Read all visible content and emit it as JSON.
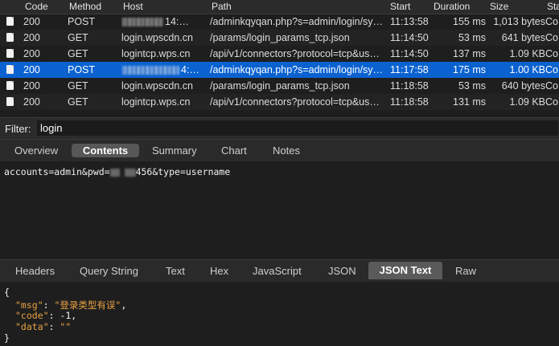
{
  "table": {
    "columns": [
      "Code",
      "Method",
      "Host",
      "Path",
      "Start",
      "Duration",
      "Size",
      "Sta"
    ],
    "rows": [
      {
        "code": "200",
        "method": "POST",
        "host": "14:…",
        "path": "/adminkqyqan.php?s=admin/login/sy…",
        "start": "11:13:58",
        "duration": "155 ms",
        "size": "1,013 bytes",
        "status": "Co",
        "masked": true,
        "selected": false
      },
      {
        "code": "200",
        "method": "GET",
        "host": "login.wpscdn.cn",
        "path": "/params/login_params_tcp.json",
        "start": "11:14:50",
        "duration": "53 ms",
        "size": "641 bytes",
        "status": "Co",
        "masked": false,
        "selected": false
      },
      {
        "code": "200",
        "method": "GET",
        "host": "logintcp.wps.cn",
        "path": "/api/v1/connectors?protocol=tcp&us…",
        "start": "11:14:50",
        "duration": "137 ms",
        "size": "1.09 KB",
        "status": "Co",
        "masked": false,
        "selected": false
      },
      {
        "code": "200",
        "method": "POST",
        "host": "4:…",
        "path": "/adminkqyqan.php?s=admin/login/sy…",
        "start": "11:17:58",
        "duration": "175 ms",
        "size": "1.00 KB",
        "status": "Co",
        "masked": true,
        "selected": true
      },
      {
        "code": "200",
        "method": "GET",
        "host": "login.wpscdn.cn",
        "path": "/params/login_params_tcp.json",
        "start": "11:18:58",
        "duration": "53 ms",
        "size": "640 bytes",
        "status": "Co",
        "masked": false,
        "selected": false
      },
      {
        "code": "200",
        "method": "GET",
        "host": "logintcp.wps.cn",
        "path": "/api/v1/connectors?protocol=tcp&us…",
        "start": "11:18:58",
        "duration": "131 ms",
        "size": "1.09 KB",
        "status": "Co",
        "masked": false,
        "selected": false
      }
    ]
  },
  "filter": {
    "label": "Filter:",
    "value": "login"
  },
  "request_tabs": {
    "overview": "Overview",
    "contents": "Contents",
    "summary": "Summary",
    "chart": "Chart",
    "notes": "Notes"
  },
  "request_body": {
    "prefix": "accounts=admin&pwd=",
    "suffix": "456&type=username"
  },
  "response_tabs": {
    "headers": "Headers",
    "query_string": "Query String",
    "text": "Text",
    "hex": "Hex",
    "javascript": "JavaScript",
    "json": "JSON",
    "json_text": "JSON Text",
    "raw": "Raw"
  },
  "response_json": {
    "open": "{",
    "close": "}",
    "lines": [
      {
        "key": "\"msg\"",
        "value": "\"登录类型有误\"",
        "sep": ",",
        "value_type": "string"
      },
      {
        "key": "\"code\"",
        "value": "-1",
        "sep": ",",
        "value_type": "number"
      },
      {
        "key": "\"data\"",
        "value": "\"\"",
        "sep": "",
        "value_type": "string"
      }
    ]
  },
  "colors": {
    "selection": "#0a62d0",
    "json_accent": "#e9a243",
    "background": "#1e1e1e"
  }
}
